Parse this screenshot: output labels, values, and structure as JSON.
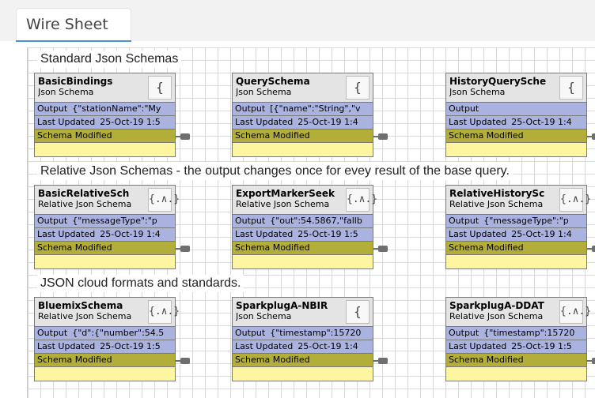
{
  "tab": {
    "title": "Wire Sheet"
  },
  "sections": [
    {
      "heading": "Standard Json Schemas"
    },
    {
      "heading": "Relative Json Schemas - the output changes once for evey result of the base query."
    },
    {
      "heading": "JSON cloud formats and standards."
    }
  ],
  "row_labels": {
    "output": "Output",
    "last_updated": "Last Updated",
    "schema_modified": "Schema Modified"
  },
  "components": [
    {
      "name": "BasicBindings",
      "type": "Json Schema",
      "icon": "{ }",
      "icon_name": "json-braces-icon",
      "output": "{\"stationName\":\"My",
      "last_updated": "25-Oct-19 1:5"
    },
    {
      "name": "QuerySchema",
      "type": "Json Schema",
      "icon": "{ }",
      "icon_name": "json-braces-icon",
      "output": "[{\"name\":\"String\",\"v",
      "last_updated": "25-Oct-19 1:4"
    },
    {
      "name": "HistoryQuerySche",
      "type": "Json Schema",
      "icon": "{ }",
      "icon_name": "json-braces-icon",
      "output": "",
      "last_updated": "25-Oct-19 1:4"
    },
    {
      "name": "BasicRelativeSch",
      "type": "Relative Json Schema",
      "icon": "{.∧.}",
      "icon_name": "relative-json-icon",
      "output": "{\"messageType\":\"p",
      "last_updated": "25-Oct-19 1:4"
    },
    {
      "name": "ExportMarkerSeek",
      "type": "Relative Json Schema",
      "icon": "{.∧.}",
      "icon_name": "relative-json-icon",
      "output": "{\"out\":54.5867,\"fallb",
      "last_updated": "25-Oct-19 1:5"
    },
    {
      "name": "RelativeHistorySc",
      "type": "Relative Json Schema",
      "icon": "{.∧.}",
      "icon_name": "relative-json-icon",
      "output": "{\"messageType\":\"p",
      "last_updated": "25-Oct-19 1:4"
    },
    {
      "name": "BluemixSchema",
      "type": "Relative Json Schema",
      "icon": "{.∧.}",
      "icon_name": "relative-json-icon",
      "output": "{\"d\":{\"number\":54.5",
      "last_updated": "25-Oct-19 1:5"
    },
    {
      "name": "SparkplugA-NBIR",
      "type": "Json Schema",
      "icon": "{ }",
      "icon_name": "json-braces-icon",
      "output": "{\"timestamp\":15720",
      "last_updated": "25-Oct-19 1:4"
    },
    {
      "name": "SparkplugA-DDAT",
      "type": "Relative Json Schema",
      "icon": "{.∧.}",
      "icon_name": "relative-json-icon",
      "output": "{\"timestamp\":15720",
      "last_updated": "25-Oct-19 1:5"
    }
  ],
  "colors": {
    "slot_blue": "#aab2e0",
    "slot_olive": "#b3ad3a",
    "slot_empty": "#fdf5a0",
    "header_gray": "#e4e4e4",
    "tab_underline": "#4a90d9"
  }
}
